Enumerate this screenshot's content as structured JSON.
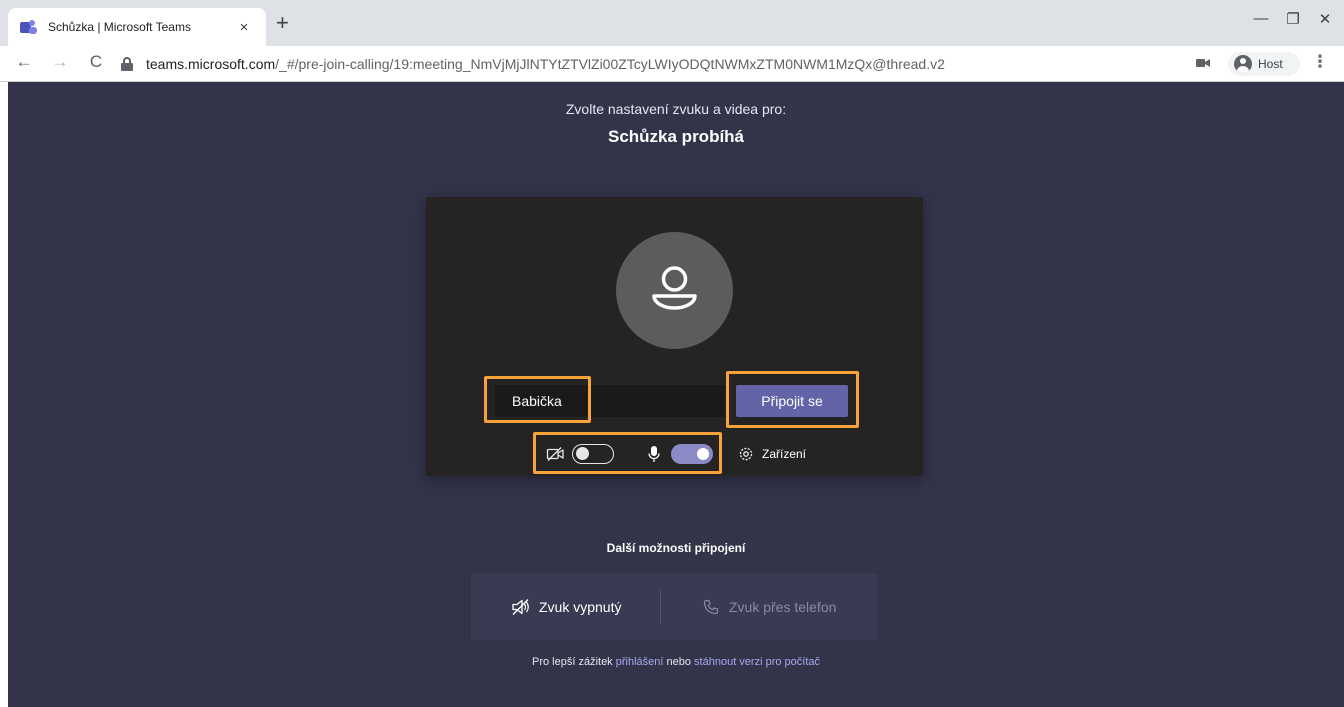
{
  "browser": {
    "tab_title": "Schůzka | Microsoft Teams",
    "url_host": "teams.microsoft.com",
    "url_path": "/_#/pre-join-calling/19:meeting_NmVjMjJlNTYtZTVlZi00ZTcyLWIyODQtNWMxZTM0NWM1MzQx@thread.v2",
    "profile_label": "Host",
    "tab_close": "×",
    "new_tab": "+",
    "window_controls": {
      "minimize": "—",
      "restore": "❐",
      "close": "✕"
    },
    "nav": {
      "back": "←",
      "forward": "→",
      "reload": "C",
      "menu": "⋮"
    }
  },
  "prejoin": {
    "subtitle": "Zvolte nastavení zvuku a videa pro:",
    "meeting_title": "Schůzka probíhá",
    "name_value": "Babička",
    "join_label": "Připojit se",
    "camera_on": false,
    "mic_on": true,
    "devices_label": "Zařízení"
  },
  "more_options": {
    "title": "Další možnosti připojení",
    "audio_off_label": "Zvuk vypnutý",
    "phone_audio_label": "Zvuk přes telefon"
  },
  "footer": {
    "prefix": "Pro lepší zážitek ",
    "signin_link": "přihlášení",
    "middle": " nebo ",
    "download_link": "stáhnout verzi pro počítač"
  },
  "colors": {
    "background": "#33344a",
    "preview_bg": "#252423",
    "accent": "#6264a7",
    "toggle_on": "#8b8cc7",
    "highlight": "#f7a23b",
    "link": "#a7a9f0"
  },
  "icons": {
    "camera_off": "video-off-icon",
    "mic": "microphone-icon",
    "devices": "gear-icon",
    "audio_off": "speaker-off-icon",
    "phone": "phone-icon",
    "avatar": "person-icon"
  }
}
